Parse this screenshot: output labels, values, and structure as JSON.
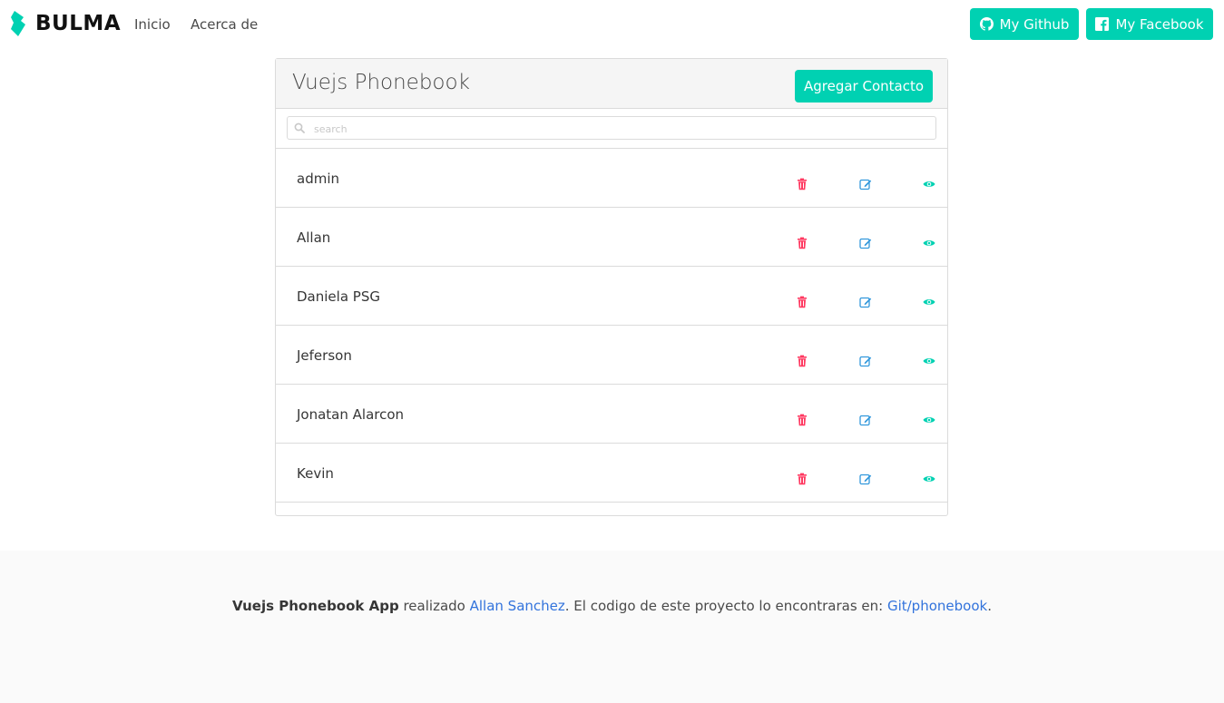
{
  "navbar": {
    "brand": "BULMA",
    "links": [
      "Inicio",
      "Acerca de"
    ],
    "github_label": "My Github",
    "facebook_label": "My Facebook"
  },
  "card": {
    "title": "Vuejs Phonebook",
    "add_button": "Agregar Contacto",
    "search_placeholder": "search",
    "contacts": [
      "admin",
      "Allan",
      "Daniela PSG",
      "Jeferson",
      "Jonatan Alarcon",
      "Kevin"
    ]
  },
  "footer": {
    "app_name": "Vuejs Phonebook App",
    "text1": " realizado ",
    "author": "Allan Sanchez",
    "text2": ". El codigo de este proyecto lo encontraras en: ",
    "repo": "Git/phonebook",
    "text3": "."
  },
  "colors": {
    "primary": "#00d1b2",
    "danger": "#ff3860",
    "info": "#3298dc",
    "link": "#3273dc"
  }
}
